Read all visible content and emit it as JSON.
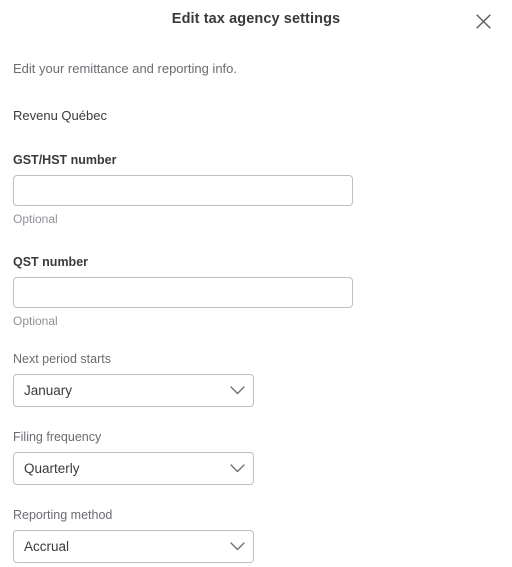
{
  "header": {
    "title": "Edit tax agency settings",
    "close_icon": "close-icon"
  },
  "body": {
    "subtitle": "Edit your remittance and reporting info.",
    "agency_name": "Revenu Québec"
  },
  "fields": [
    {
      "label": "GST/HST number",
      "value": "",
      "placeholder": "",
      "helper": "Optional"
    },
    {
      "label": "QST number",
      "value": "",
      "placeholder": "",
      "helper": "Optional"
    }
  ],
  "selects": [
    {
      "label": "Next period starts",
      "value": "January",
      "icon": "chevron-down-icon"
    },
    {
      "label": "Filing frequency",
      "value": "Quarterly",
      "icon": "chevron-down-icon"
    },
    {
      "label": "Reporting method",
      "value": "Accrual",
      "icon": "chevron-down-icon"
    }
  ],
  "colors": {
    "text_primary": "#393a3d",
    "text_secondary": "#6b6c72",
    "text_muted": "#8d9096",
    "border": "#babec5",
    "background": "#ffffff"
  }
}
